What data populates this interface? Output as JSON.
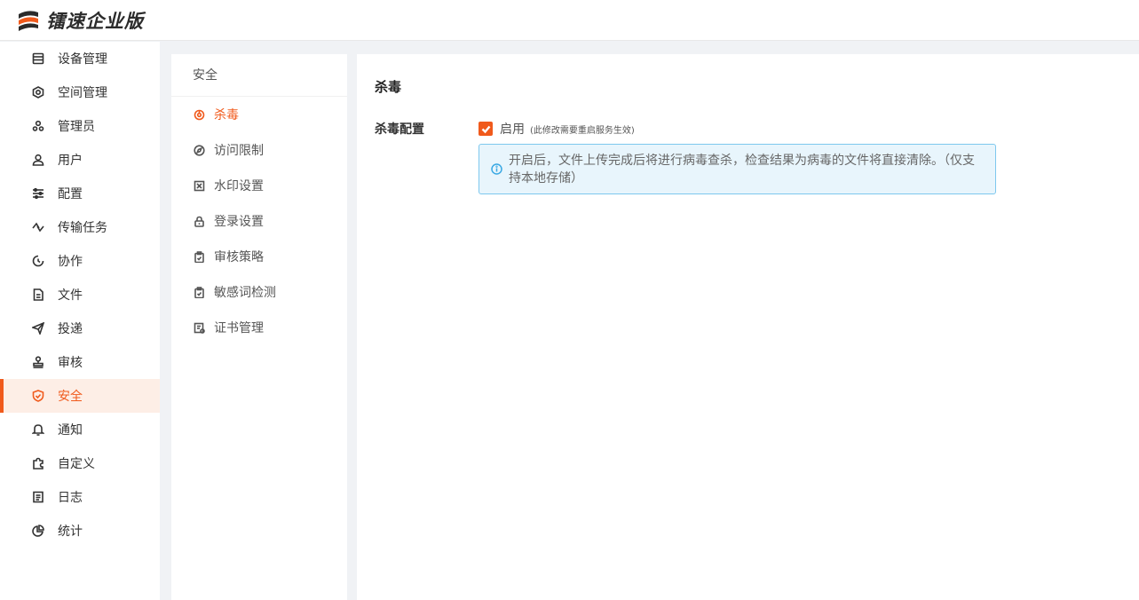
{
  "brand": {
    "name": "镭速企业版",
    "accent": "#f05a1c"
  },
  "sidebar": {
    "items": [
      {
        "label": "设备管理",
        "icon": "device-list-icon"
      },
      {
        "label": "空间管理",
        "icon": "hexagon-space-icon"
      },
      {
        "label": "管理员",
        "icon": "admin-group-icon"
      },
      {
        "label": "用户",
        "icon": "user-icon"
      },
      {
        "label": "配置",
        "icon": "sliders-icon"
      },
      {
        "label": "传输任务",
        "icon": "transfer-icon"
      },
      {
        "label": "协作",
        "icon": "collaborate-icon"
      },
      {
        "label": "文件",
        "icon": "file-icon"
      },
      {
        "label": "投递",
        "icon": "send-plane-icon"
      },
      {
        "label": "审核",
        "icon": "stamp-icon"
      },
      {
        "label": "安全",
        "icon": "shield-icon",
        "active": true
      },
      {
        "label": "通知",
        "icon": "bell-icon"
      },
      {
        "label": "自定义",
        "icon": "puzzle-icon"
      },
      {
        "label": "日志",
        "icon": "log-icon"
      },
      {
        "label": "统计",
        "icon": "pie-chart-icon"
      }
    ]
  },
  "subpanel": {
    "title": "安全",
    "items": [
      {
        "label": "杀毒",
        "icon": "virus-icon",
        "active": true
      },
      {
        "label": "访问限制",
        "icon": "compass-icon"
      },
      {
        "label": "水印设置",
        "icon": "watermark-icon"
      },
      {
        "label": "登录设置",
        "icon": "lock-icon"
      },
      {
        "label": "审核策略",
        "icon": "clipboard-icon"
      },
      {
        "label": "敏感词检测",
        "icon": "clipboard-check-icon"
      },
      {
        "label": "证书管理",
        "icon": "certificate-icon"
      }
    ]
  },
  "content": {
    "title": "杀毒",
    "form_label": "杀毒配置",
    "checkbox_label": "启用",
    "checkbox_checked": true,
    "checkbox_note": "(此修改需要重启服务生效)",
    "info_text": "开启后，文件上传完成后将进行病毒查杀，检查结果为病毒的文件将直接清除。（仅支持本地存储）"
  }
}
